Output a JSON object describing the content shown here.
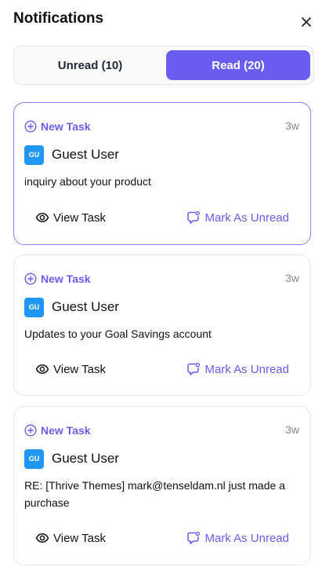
{
  "header": {
    "title": "Notifications"
  },
  "tabs": {
    "unread_label": "Unread (10)",
    "read_label": "Read (20)"
  },
  "colors": {
    "accent": "#6b5cf0",
    "avatar": "#2196f3"
  },
  "notifications": [
    {
      "type": "New Task",
      "age": "3w",
      "avatar_initials": "GU",
      "user": "Guest User",
      "message": "inquiry about your product",
      "view_label": "View Task",
      "mark_label": "Mark As Unread"
    },
    {
      "type": "New Task",
      "age": "3w",
      "avatar_initials": "GU",
      "user": "Guest User",
      "message": "Updates to your Goal Savings account",
      "view_label": "View Task",
      "mark_label": "Mark As Unread"
    },
    {
      "type": "New Task",
      "age": "3w",
      "avatar_initials": "GU",
      "user": "Guest User",
      "message": "RE: [Thrive Themes] mark@tenseldam.nl just made a purchase",
      "view_label": "View Task",
      "mark_label": "Mark As Unread"
    }
  ]
}
